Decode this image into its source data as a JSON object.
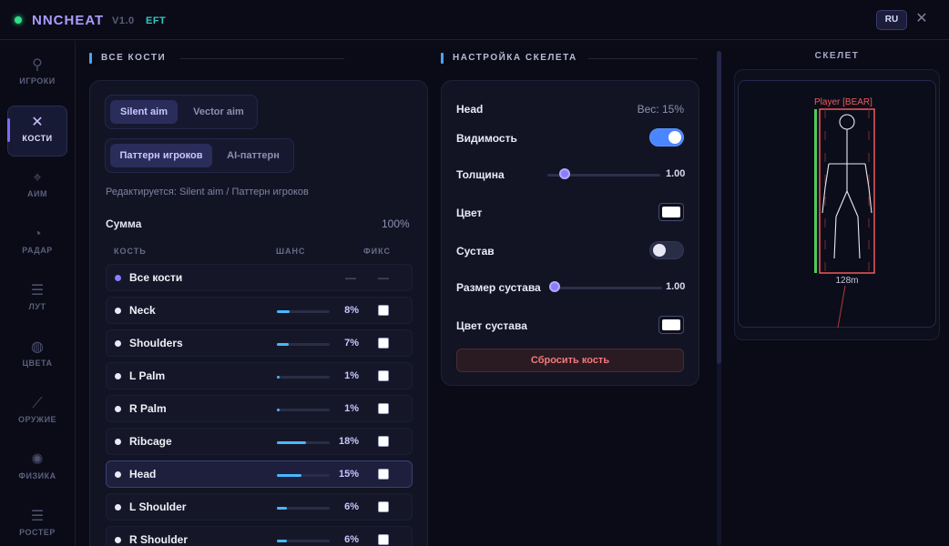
{
  "app": {
    "title": "NNCHEAT",
    "version": "V1.0",
    "tag": "EFT",
    "lang": "RU",
    "close": "✕",
    "status_color": "#2ee08a",
    "accent": "#7d6bff"
  },
  "sidebar": {
    "items": [
      {
        "label": "ИГРОКИ",
        "icon": "person-icon",
        "glyph": "⚲"
      },
      {
        "label": "КОСТИ",
        "icon": "bones-icon",
        "glyph": "✕",
        "active": true
      },
      {
        "label": "АИМ",
        "icon": "crosshair-icon",
        "glyph": "⌖"
      },
      {
        "label": "РАДАР",
        "icon": "radar-icon",
        "glyph": "◔"
      },
      {
        "label": "ЛУТ",
        "icon": "list-icon",
        "glyph": "☰"
      },
      {
        "label": "ЦВЕТА",
        "icon": "palette-icon",
        "glyph": "◍"
      },
      {
        "label": "ОРУЖИЕ",
        "icon": "rifle-icon",
        "glyph": "⟋"
      },
      {
        "label": "ФИЗИКА",
        "icon": "atom-icon",
        "glyph": "✺"
      },
      {
        "label": "РОСТЕР",
        "icon": "list-icon",
        "glyph": "☰"
      }
    ]
  },
  "bones": {
    "heading": "ВСЕ КОСТИ",
    "aim_modes": [
      "Silent aim",
      "Vector aim"
    ],
    "patterns": [
      "Паттерн игроков",
      "AI-паттерн"
    ],
    "editing": "Редактируется: Silent aim / Паттерн игроков",
    "sum_label": "Сумма",
    "sum_value": "100%",
    "columns": {
      "bone": "КОСТЬ",
      "chance": "ШАНС",
      "fix": "ФИКС"
    },
    "all_row": {
      "name": "Все кости",
      "chance": "—",
      "fix": "—"
    },
    "rows": [
      {
        "name": "Neck",
        "chance": "8%",
        "value": 8
      },
      {
        "name": "Shoulders",
        "chance": "7%",
        "value": 7
      },
      {
        "name": "L Palm",
        "chance": "1%",
        "value": 1
      },
      {
        "name": "R Palm",
        "chance": "1%",
        "value": 1
      },
      {
        "name": "Ribcage",
        "chance": "18%",
        "value": 18
      },
      {
        "name": "Head",
        "chance": "15%",
        "value": 15,
        "selected": true
      },
      {
        "name": "L Shoulder",
        "chance": "6%",
        "value": 6
      },
      {
        "name": "R Shoulder",
        "chance": "6%",
        "value": 6
      }
    ]
  },
  "settings": {
    "heading": "НАСТРОЙКА СКЕЛЕТА",
    "bone": "Head",
    "weight": "Вес: 15%",
    "visibility_label": "Видимость",
    "visibility_on": true,
    "thickness_label": "Толщина",
    "thickness_value": "1.00",
    "thickness_level": 0.15,
    "color_label": "Цвет",
    "color": "#ffffff",
    "joint_label": "Сустав",
    "joint_on": false,
    "joint_size_label": "Размер сустава",
    "joint_size_value": "1.00",
    "joint_size_level": 0.0,
    "joint_color_label": "Цвет сустава",
    "joint_color": "#ffffff",
    "reset_label": "Сбросить кость"
  },
  "preview": {
    "heading": "СКЕЛЕТ",
    "player_tag": "Player [BEAR]",
    "distance": "128m",
    "box_color": "#f25a5a",
    "health_color": "#4ecb5a"
  }
}
